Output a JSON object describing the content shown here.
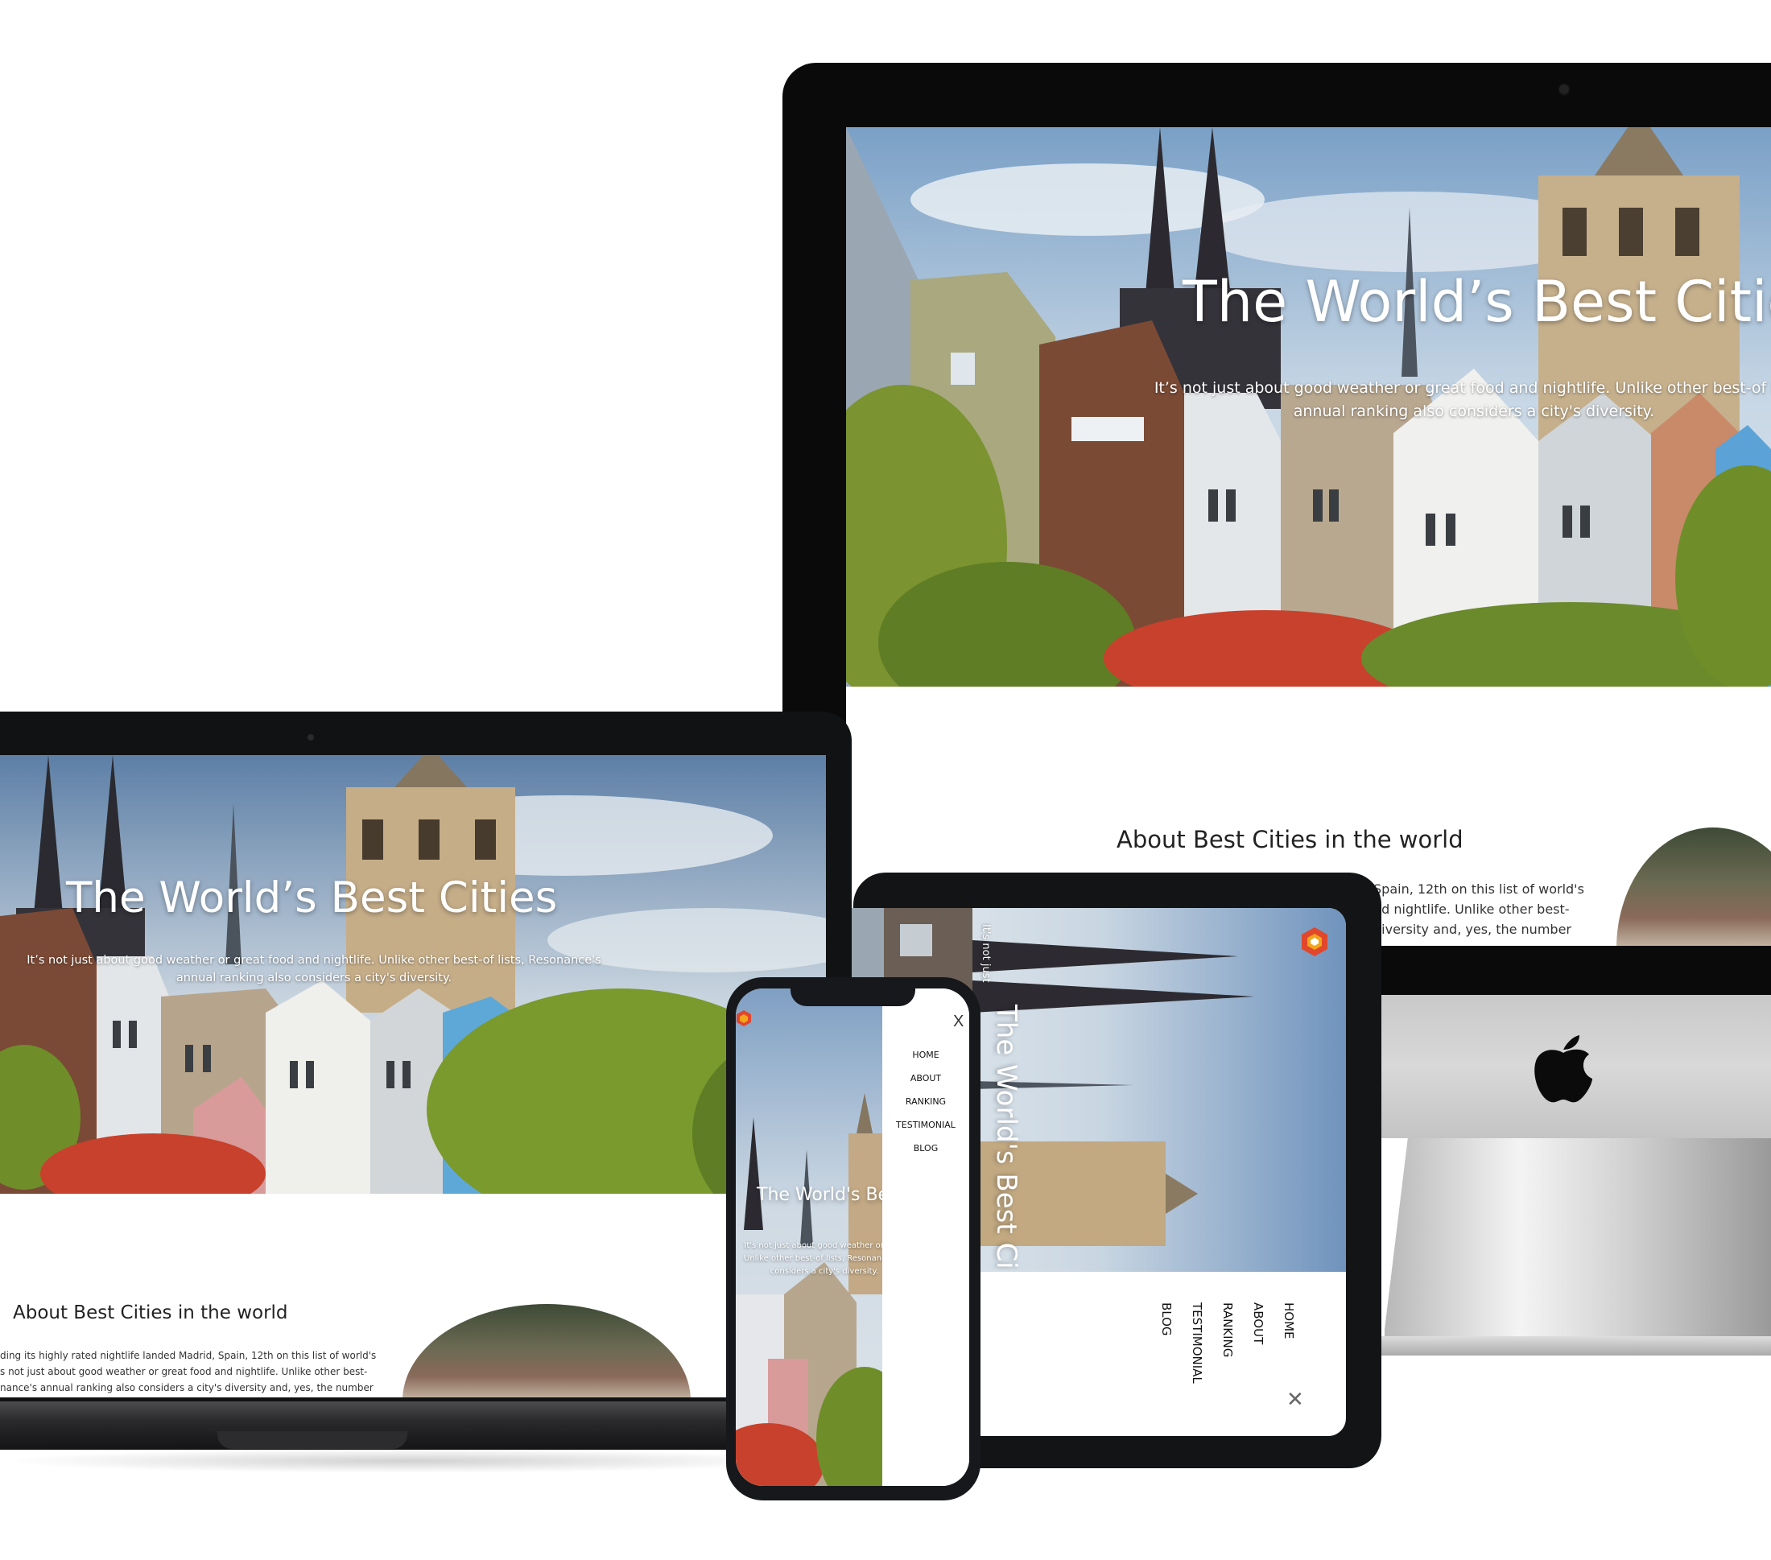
{
  "site": {
    "hero_title": "The World’s Best Cities",
    "hero_title_imac": "The World’s Best Citie",
    "hero_title_phone": "The World's Best",
    "hero_title_tablet": "The World's Best Ci",
    "hero_sub_line1": "It’s not just about good weather or great food and nightlife. Unlike other best-of lists, Resonance's",
    "hero_sub_line2": "annual ranking also considers a city's diversity.",
    "imac_sub_line1": "It’s not just about good weather or great food and nightlife. Unlike other best-of list",
    "imac_sub_line2": "annual ranking also considers a city's diversity.",
    "tablet_sub_fragment": "It's not just",
    "phone_sub_line1": "It's not just about good weather or grea",
    "phone_sub_line2": "Unlike other best-of lists, Resonance's a",
    "phone_sub_line3": "considers a city's diversity.",
    "about_title": "About Best Cities in the world",
    "about_laptop_line1": "ding its highly rated nightlife landed Madrid, Spain, 12th on this list of world's",
    "about_laptop_line2": "s not just about good weather or great food and nightlife. Unlike other best-",
    "about_laptop_line3": "nance's annual ranking also considers a city's diversity and, yes, the number",
    "about_imac_line1": "Spain, 12th on this list of world's",
    "about_imac_line2": "nd nightlife. Unlike other best-",
    "about_imac_line3": "diversity and, yes, the number"
  },
  "menu": {
    "items": [
      "HOME",
      "ABOUT",
      "RANKING",
      "TESTIMONIAL",
      "BLOG"
    ],
    "close_label": "X",
    "tablet_close_label": "✕"
  },
  "icons": {
    "imac_logo": "apple-logo-icon",
    "brand_logo": "hexagon-logo-icon",
    "close": "close-icon"
  },
  "colors": {
    "sky": "#8fb1cf",
    "stone": "#c8b79a",
    "tree": "#6f8e2a",
    "autumn": "#c8412c",
    "logo_red": "#e0472c",
    "logo_orange": "#f4a51c"
  }
}
